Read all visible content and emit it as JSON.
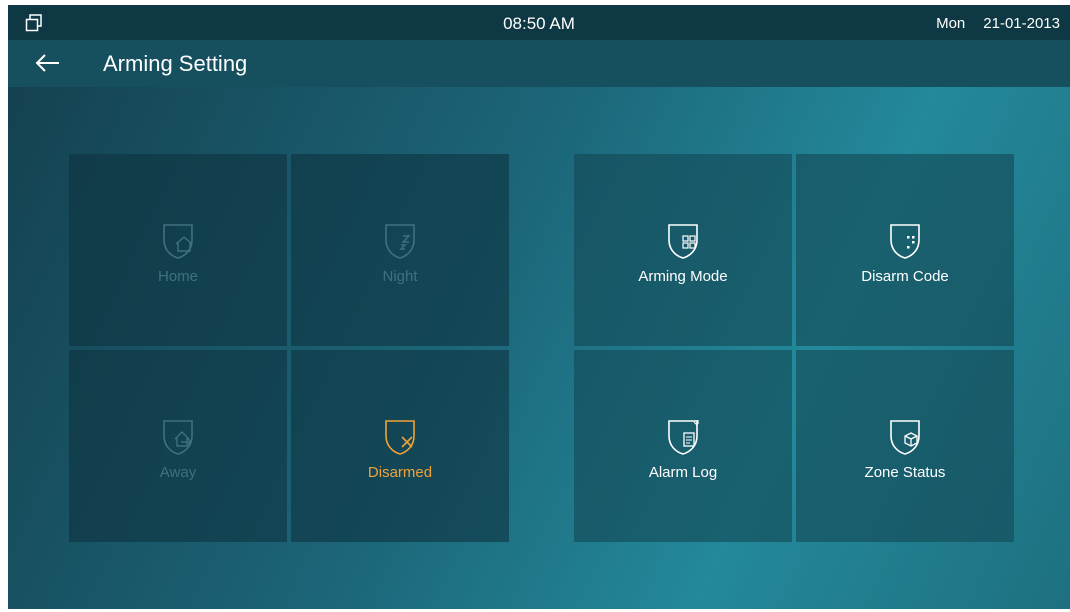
{
  "status": {
    "time": "08:50 AM",
    "day": "Mon",
    "date": "21-01-2013",
    "window_icon": "window-restore-icon"
  },
  "header": {
    "title": "Arming Setting",
    "back_icon": "arrow-left-icon"
  },
  "arming_modes": [
    {
      "label": "Home",
      "icon": "shield-home-icon",
      "state": "inactive"
    },
    {
      "label": "Night",
      "icon": "shield-night-icon",
      "state": "inactive"
    },
    {
      "label": "Away",
      "icon": "shield-away-icon",
      "state": "inactive"
    },
    {
      "label": "Disarmed",
      "icon": "shield-x-icon",
      "state": "active"
    }
  ],
  "settings": [
    {
      "label": "Arming Mode",
      "icon": "shield-grid-icon"
    },
    {
      "label": "Disarm Code",
      "icon": "shield-keypad-icon"
    },
    {
      "label": "Alarm Log",
      "icon": "shield-document-icon"
    },
    {
      "label": "Zone Status",
      "icon": "shield-cube-icon"
    }
  ],
  "colors": {
    "active": "#f0a23a",
    "inactive": "#3e7180",
    "text": "#ffffff"
  }
}
